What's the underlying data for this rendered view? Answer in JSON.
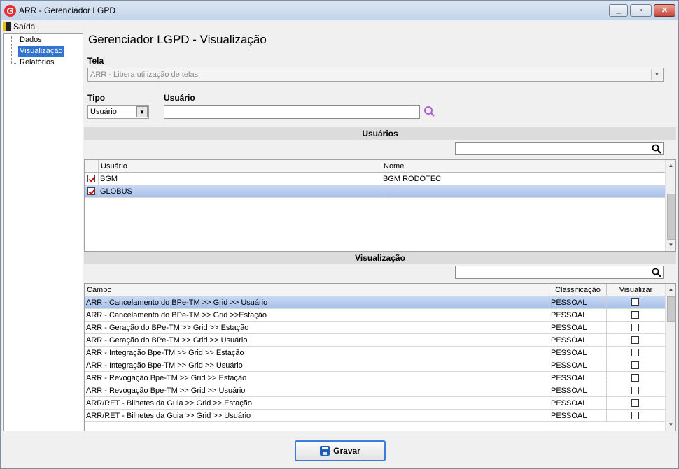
{
  "window": {
    "title": "ARR - Gerenciador LGPD",
    "app_icon_letter": "G"
  },
  "menubar": {
    "exit_label": "Saída"
  },
  "sidebar": {
    "items": [
      {
        "label": "Dados",
        "selected": false
      },
      {
        "label": "Visualização",
        "selected": true
      },
      {
        "label": "Relatórios",
        "selected": false
      }
    ]
  },
  "page": {
    "title": "Gerenciador LGPD - Visualização"
  },
  "form": {
    "tela_label": "Tela",
    "tela_value": "ARR - Libera utilização de telas",
    "tipo_label": "Tipo",
    "tipo_value": "Usuário",
    "usuario_label": "Usuário",
    "usuario_value": ""
  },
  "usuarios_section": {
    "header": "Usuários",
    "filter_value": "",
    "columns": [
      "Usuário",
      "Nome"
    ],
    "rows": [
      {
        "checked": true,
        "usuario": "BGM",
        "nome": "BGM RODOTEC",
        "selected": false
      },
      {
        "checked": true,
        "usuario": "GLOBUS",
        "nome": "",
        "selected": true
      }
    ]
  },
  "visualizacao_section": {
    "header": "Visualização",
    "filter_value": "",
    "columns": [
      "Campo",
      "Classificação",
      "Visualizar"
    ],
    "rows": [
      {
        "campo": "ARR - Cancelamento do BPe-TM >> Grid >> Usuário",
        "classificacao": "PESSOAL",
        "visualizar": false,
        "selected": true
      },
      {
        "campo": "ARR - Cancelamento do BPe-TM >> Grid >>Estação",
        "classificacao": "PESSOAL",
        "visualizar": false,
        "selected": false
      },
      {
        "campo": "ARR - Geração do BPe-TM >> Grid >> Estação",
        "classificacao": "PESSOAL",
        "visualizar": false,
        "selected": false
      },
      {
        "campo": "ARR - Geração do BPe-TM >> Grid >> Usuário",
        "classificacao": "PESSOAL",
        "visualizar": false,
        "selected": false
      },
      {
        "campo": "ARR - Integração Bpe-TM >> Grid >> Estação",
        "classificacao": "PESSOAL",
        "visualizar": false,
        "selected": false
      },
      {
        "campo": "ARR - Integração Bpe-TM >> Grid >> Usuário",
        "classificacao": "PESSOAL",
        "visualizar": false,
        "selected": false
      },
      {
        "campo": "ARR - Revogação Bpe-TM >> Grid >> Estação",
        "classificacao": "PESSOAL",
        "visualizar": false,
        "selected": false
      },
      {
        "campo": "ARR - Revogação Bpe-TM >> Grid >> Usuário",
        "classificacao": "PESSOAL",
        "visualizar": false,
        "selected": false
      },
      {
        "campo": "ARR/RET - Bilhetes da Guia >> Grid >> Estação",
        "classificacao": "PESSOAL",
        "visualizar": false,
        "selected": false
      },
      {
        "campo": "ARR/RET - Bilhetes da Guia >> Grid >> Usuário",
        "classificacao": "PESSOAL",
        "visualizar": false,
        "selected": false
      }
    ]
  },
  "buttons": {
    "save_label": "Gravar"
  },
  "colors": {
    "accent": "#3374cd",
    "selection": "#a7c0eb",
    "check": "#cc0000",
    "search_icon": "#b15fd1"
  }
}
